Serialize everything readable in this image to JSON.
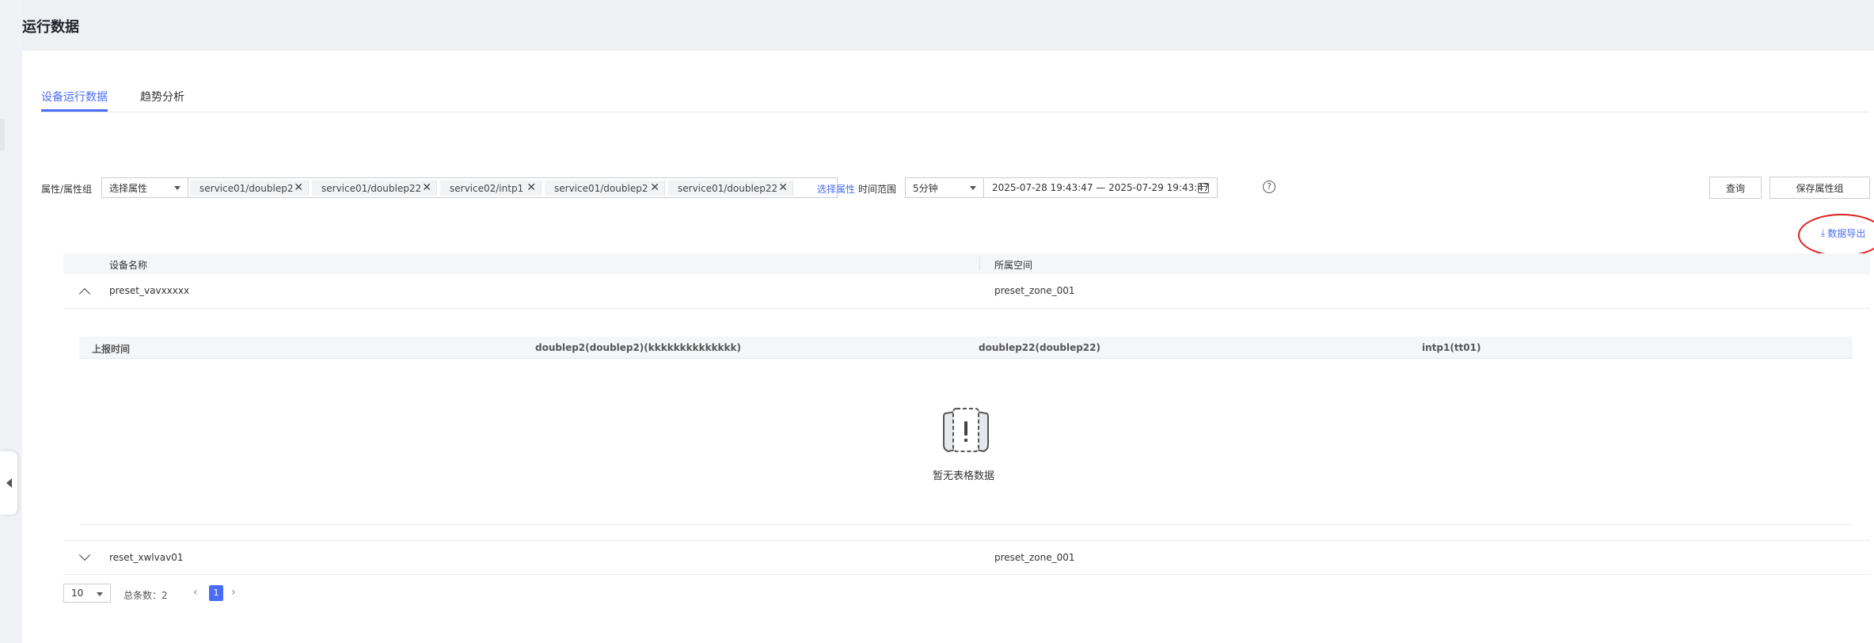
{
  "page": {
    "title": "运行数据"
  },
  "tabs": [
    {
      "label": "设备运行数据",
      "active": true
    },
    {
      "label": "趋势分析",
      "active": false
    }
  ],
  "filters": {
    "attr_label": "属性/属性组",
    "attr_select": "选择属性",
    "tags": [
      "service01/doublep2",
      "service01/doublep22",
      "service02/intp1",
      "service01/doublep2",
      "service01/doublep22"
    ],
    "select_link": "选择属性",
    "time_label": "时间范围",
    "time_select": "5分钟",
    "date_range": "2025-07-28 19:43:47 — 2025-07-29 19:43:47",
    "help": "?"
  },
  "buttons": {
    "query": "查询",
    "save_group": "保存属性组"
  },
  "export": {
    "label": "数据导出",
    "icon": "download-icon"
  },
  "table": {
    "headers": [
      "设备名称",
      "所属空间"
    ],
    "rows": [
      {
        "name": "preset_vavxxxxx",
        "space": "preset_zone_001",
        "expanded": true
      },
      {
        "name": "reset_xwlvav01",
        "space": "preset_zone_001",
        "expanded": false
      }
    ],
    "sub_headers": [
      "上报时间",
      "doublep2(doublep2)(kkkkkkkkkkkkkk)",
      "doublep22(doublep22)",
      "intp1(tt01)"
    ],
    "empty_text": "暂无表格数据"
  },
  "pagination": {
    "page_size": "10",
    "total": "总条数：2",
    "current_page": "1",
    "prev": "‹",
    "next": "›"
  },
  "colors": {
    "accent": "#4a6cf7",
    "annotation": "#e02020"
  }
}
